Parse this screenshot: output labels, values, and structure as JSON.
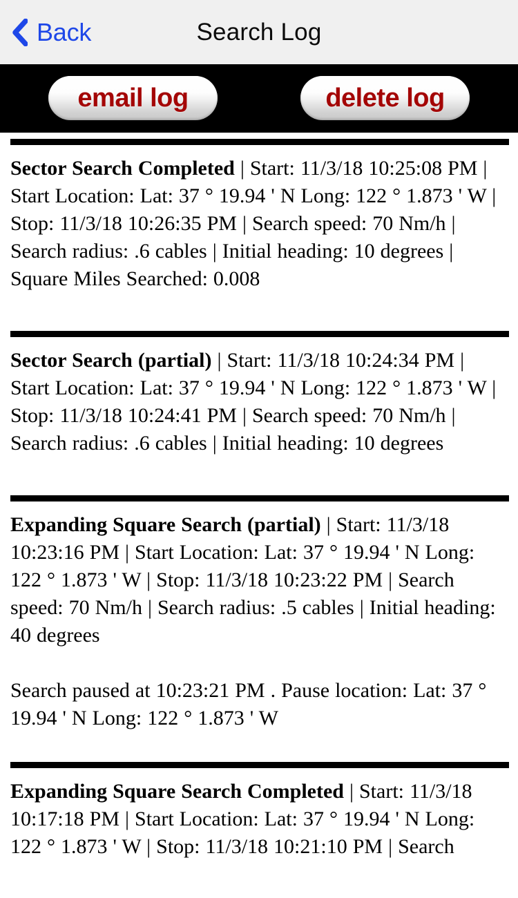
{
  "navbar": {
    "back_label": "Back",
    "back_icon": "chevron-left-icon",
    "title": "Search Log"
  },
  "toolbar": {
    "email_label": "email log",
    "delete_label": "delete log",
    "background_color": "#000000",
    "button_text_color": "#a40606"
  },
  "colors": {
    "nav_background": "#f0f0f0",
    "back_blue": "#1e47e8",
    "divider": "#000000",
    "page_background": "#ffffff"
  },
  "log_entries": [
    {
      "title": "Sector Search Completed",
      "body": " | Start: 11/3/18 10:25:08 PM | Start Location: Lat: 37 ° 19.94 ' N Long: 122 ° 1.873 ' W | Stop: 11/3/18 10:26:35 PM | Search speed: 70 Nm/h | Search radius: .6 cables | Initial heading: 10 degrees | Square Miles Searched: 0.008",
      "note": ""
    },
    {
      "title": "Sector Search (partial)",
      "body": " | Start: 11/3/18 10:24:34 PM | Start Location: Lat: 37 ° 19.94 ' N Long: 122 ° 1.873 ' W | Stop: 11/3/18 10:24:41 PM | Search speed: 70 Nm/h | Search radius: .6 cables | Initial heading: 10 degrees",
      "note": ""
    },
    {
      "title": "Expanding Square Search (partial)",
      "body": " | Start: 11/3/18 10:23:16 PM | Start Location: Lat: 37 ° 19.94 ' N Long: 122 ° 1.873 ' W | Stop: 11/3/18 10:23:22 PM | Search speed: 70 Nm/h | Search radius: .5 cables | Initial heading: 40 degrees",
      "note": "Search paused at 10:23:21 PM . Pause location: Lat: 37 ° 19.94 ' N Long: 122 ° 1.873 ' W"
    },
    {
      "title": "Expanding Square Search Completed",
      "body": " | Start: 11/3/18 10:17:18 PM | Start Location: Lat: 37 ° 19.94 ' N Long: 122 ° 1.873 ' W | Stop: 11/3/18 10:21:10 PM | Search",
      "note": ""
    }
  ]
}
